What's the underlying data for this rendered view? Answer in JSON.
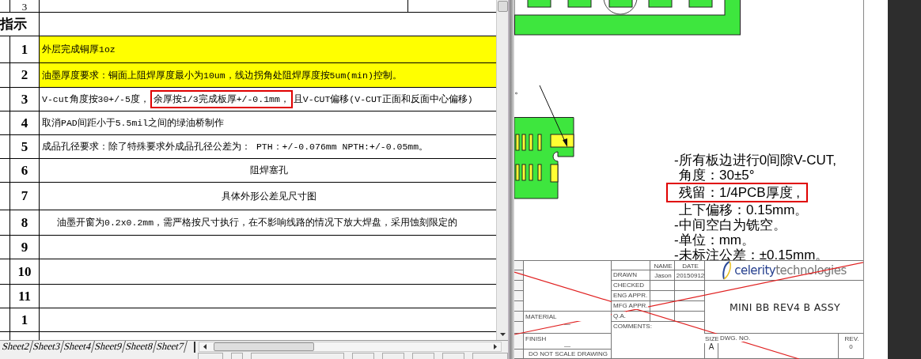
{
  "spreadsheet": {
    "top_row": {
      "number": "3"
    },
    "section_label": "指示",
    "rows": [
      {
        "number": "1",
        "highlighted": true,
        "kind": "left",
        "segments": [
          {
            "text": "外层完成铜厚1oz",
            "boxed": false
          }
        ]
      },
      {
        "number": "2",
        "highlighted": true,
        "kind": "left",
        "segments": [
          {
            "text": "油墨厚度要求：铜面上阻焊厚度最小为10um，线边拐角处阻焊厚度按5um(min)控制。",
            "boxed": false
          }
        ]
      },
      {
        "number": "3",
        "highlighted": false,
        "kind": "left",
        "segments": [
          {
            "text": "V-cut角度按30+/-5度，",
            "boxed": false
          },
          {
            "text": "余厚按1/3完成板厚+/-0.1mm，",
            "boxed": true
          },
          {
            "text": "且V-CUT偏移(V-CUT正面和反面中心偏移)",
            "boxed": false
          }
        ]
      },
      {
        "number": "4",
        "highlighted": false,
        "kind": "left",
        "segments": [
          {
            "text": "取消PAD间距小于5.5mil之间的绿油桥制作",
            "boxed": false
          }
        ]
      },
      {
        "number": "5",
        "highlighted": false,
        "kind": "left",
        "segments": [
          {
            "text": "成品孔径要求：除了特殊要求外成品孔径公差为： PTH：+/-0.076mm    NPTH:+/-0.05mm。",
            "boxed": false
          }
        ]
      },
      {
        "number": "6",
        "highlighted": false,
        "kind": "center",
        "segments": [
          {
            "text": "阻焊塞孔",
            "boxed": false
          }
        ]
      },
      {
        "number": "7",
        "highlighted": false,
        "kind": "center",
        "segments": [
          {
            "text": "具体外形公差见尺寸图",
            "boxed": false
          }
        ]
      },
      {
        "number": "8",
        "highlighted": false,
        "kind": "indent",
        "segments": [
          {
            "text": "油墨开窗为0.2x0.2mm，需严格按尺寸执行，在不影响线路的情况下放大焊盘，采用蚀刻限定的",
            "boxed": false
          }
        ]
      },
      {
        "number": "9",
        "highlighted": false,
        "segments": []
      },
      {
        "number": "10",
        "highlighted": false,
        "segments": []
      },
      {
        "number": "11",
        "highlighted": false,
        "segments": []
      },
      {
        "number": "1",
        "highlighted": false,
        "segments": []
      }
    ],
    "sheet_tabs": [
      "Sheet2",
      "Sheet3",
      "Sheet4",
      "Sheet9",
      "Sheet8",
      "Sheet7"
    ]
  },
  "drawing": {
    "cut_note": "。",
    "notes": [
      {
        "text": "-所有板边进行0间隙V-CUT,",
        "indent": false,
        "boxed": false
      },
      {
        "text": "角度：30±5°",
        "indent": true,
        "boxed": false
      },
      {
        "text": "残留：1/4PCB厚度 ,",
        "indent": true,
        "boxed": true
      },
      {
        "text": "上下偏移：0.15mm。",
        "indent": true,
        "boxed": false
      },
      {
        "text": "-中间空白为铣空。",
        "indent": false,
        "boxed": false
      },
      {
        "text": "-单位：mm。",
        "indent": false,
        "boxed": false
      },
      {
        "text": "-未标注公差：±0.15mm。",
        "indent": false,
        "boxed": false
      }
    ],
    "title_block": {
      "name_header": "NAME",
      "date_header": "DATE",
      "signoffs": [
        {
          "label": "DRAWN",
          "name": "Jason",
          "date": "20150912"
        },
        {
          "label": "CHECKED"
        },
        {
          "label": "ENG APPR."
        },
        {
          "label": "MFG APPR."
        },
        {
          "label": "Q.A."
        }
      ],
      "comments_label": "COMMENTS:",
      "material_label": "MATERIAL",
      "material_value": "—",
      "finish_label": "FINISH",
      "finish_value": "—",
      "scale_note": "DO NOT SCALE DRAWING",
      "logo": "**celerity**technologies",
      "title": "MINI BB REV4 B ASSY",
      "size_label": "SIZE",
      "size": "A",
      "dwg_no_label": "DWG. NO.",
      "rev_label": "REV.",
      "rev": "0",
      "crossed_out": true
    }
  }
}
